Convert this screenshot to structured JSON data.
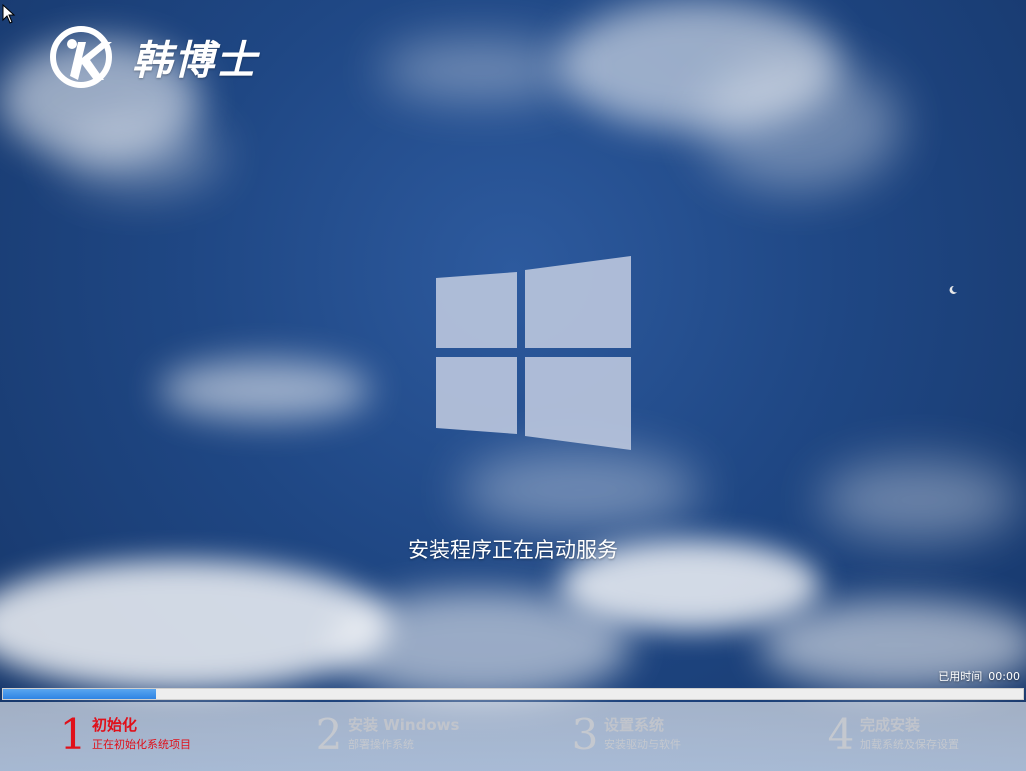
{
  "brand": {
    "name": "韩博士"
  },
  "status": {
    "message": "安装程序正在启动服务",
    "elapsed_label": "已用时间",
    "elapsed_value": "00:00",
    "progress_fraction": 0.15
  },
  "steps": [
    {
      "number": "1",
      "title": "初始化",
      "subtitle": "正在初始化系统项目",
      "active": true
    },
    {
      "number": "2",
      "title": "安装 Windows",
      "subtitle": "部署操作系统",
      "active": false
    },
    {
      "number": "3",
      "title": "设置系统",
      "subtitle": "安装驱动与软件",
      "active": false
    },
    {
      "number": "4",
      "title": "完成安装",
      "subtitle": "加载系统及保存设置",
      "active": false
    }
  ],
  "colors": {
    "active_step": "#e0101a",
    "inactive_step": "#c4c8cf",
    "progress": "#2f84e4",
    "sky": "#1f4784"
  },
  "icons": {
    "logo": "hanboshi-logo-icon",
    "windows": "windows-logo-icon",
    "cursor": "mouse-pointer-icon",
    "moon": "moon-icon"
  }
}
